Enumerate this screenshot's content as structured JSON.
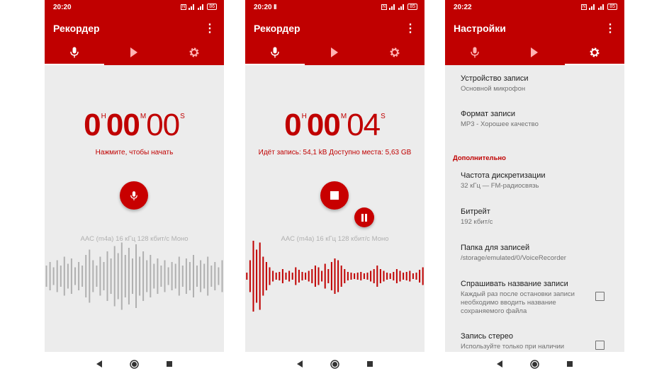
{
  "colors": {
    "accent": "#c00000",
    "wave_idle": "#b0b0b0"
  },
  "screen1": {
    "status_time": "20:20",
    "battery": "86",
    "title": "Рекордер",
    "tabs": [
      {
        "icon": "mic-icon"
      },
      {
        "icon": "play-icon"
      },
      {
        "icon": "gear-icon"
      }
    ],
    "timer": {
      "h": "0",
      "h_unit": "H",
      "m": "00",
      "m_unit": "M",
      "s": "00",
      "s_unit": "S"
    },
    "hint": "Нажмите, чтобы начать",
    "format": "AAC (m4a) 16 кГц 128 кбит/с Моно"
  },
  "screen2": {
    "status_time": "20:20",
    "pause_indicator": "II",
    "battery": "85",
    "title": "Рекордер",
    "timer": {
      "h": "0",
      "h_unit": "H",
      "m": "00",
      "m_unit": "M",
      "s": "04",
      "s_unit": "S"
    },
    "status": "Идёт запись: 54,1 kB Доступно места: 5,63 GB",
    "format": "AAC (m4a) 16 кГц 128 кбит/с Моно"
  },
  "screen3": {
    "status_time": "20:22",
    "battery": "85",
    "title": "Настройки",
    "items": [
      {
        "title": "Устройство записи",
        "subtitle": "Основной микрофон"
      },
      {
        "title": "Формат записи",
        "subtitle": "MP3 - Хорошее качество"
      },
      {
        "title": "Частота дискретизации",
        "subtitle": "32 кГц — FM-радиосвязь"
      },
      {
        "title": "Битрейт",
        "subtitle": "192 кбит/с"
      },
      {
        "title": "Папка для записей",
        "subtitle": "/storage/emulated/0/VoiceRecorder"
      },
      {
        "title": "Спрашивать название записи",
        "subtitle": "Каждый раз после остановки записи необходимо вводить название сохраняемого файла",
        "checked": false
      },
      {
        "title": "Запись стерео",
        "subtitle": "Используйте только при наличии",
        "checked": false
      }
    ],
    "section": "Дополнительно"
  },
  "waveforms": {
    "idle": [
      0.3,
      0.4,
      0.25,
      0.45,
      0.3,
      0.55,
      0.35,
      0.5,
      0.25,
      0.4,
      0.3,
      0.6,
      0.75,
      0.45,
      0.3,
      0.55,
      0.4,
      0.7,
      0.5,
      0.85,
      0.65,
      0.95,
      0.6,
      0.8,
      0.5,
      0.9,
      0.55,
      0.7,
      0.45,
      0.6,
      0.35,
      0.5,
      0.3,
      0.45,
      0.25,
      0.4,
      0.35,
      0.55,
      0.3,
      0.5,
      0.4,
      0.6,
      0.3,
      0.45,
      0.35,
      0.55,
      0.3,
      0.4,
      0.25,
      0.45
    ],
    "recording": [
      0.1,
      0.45,
      1.0,
      0.75,
      0.95,
      0.55,
      0.4,
      0.25,
      0.15,
      0.1,
      0.12,
      0.2,
      0.1,
      0.15,
      0.1,
      0.25,
      0.18,
      0.12,
      0.1,
      0.15,
      0.2,
      0.3,
      0.25,
      0.15,
      0.35,
      0.2,
      0.4,
      0.5,
      0.45,
      0.3,
      0.2,
      0.12,
      0.1,
      0.08,
      0.1,
      0.12,
      0.08,
      0.1,
      0.15,
      0.2,
      0.3,
      0.2,
      0.15,
      0.1,
      0.08,
      0.12,
      0.2,
      0.15,
      0.1,
      0.12,
      0.15,
      0.08,
      0.1,
      0.18,
      0.25
    ]
  }
}
